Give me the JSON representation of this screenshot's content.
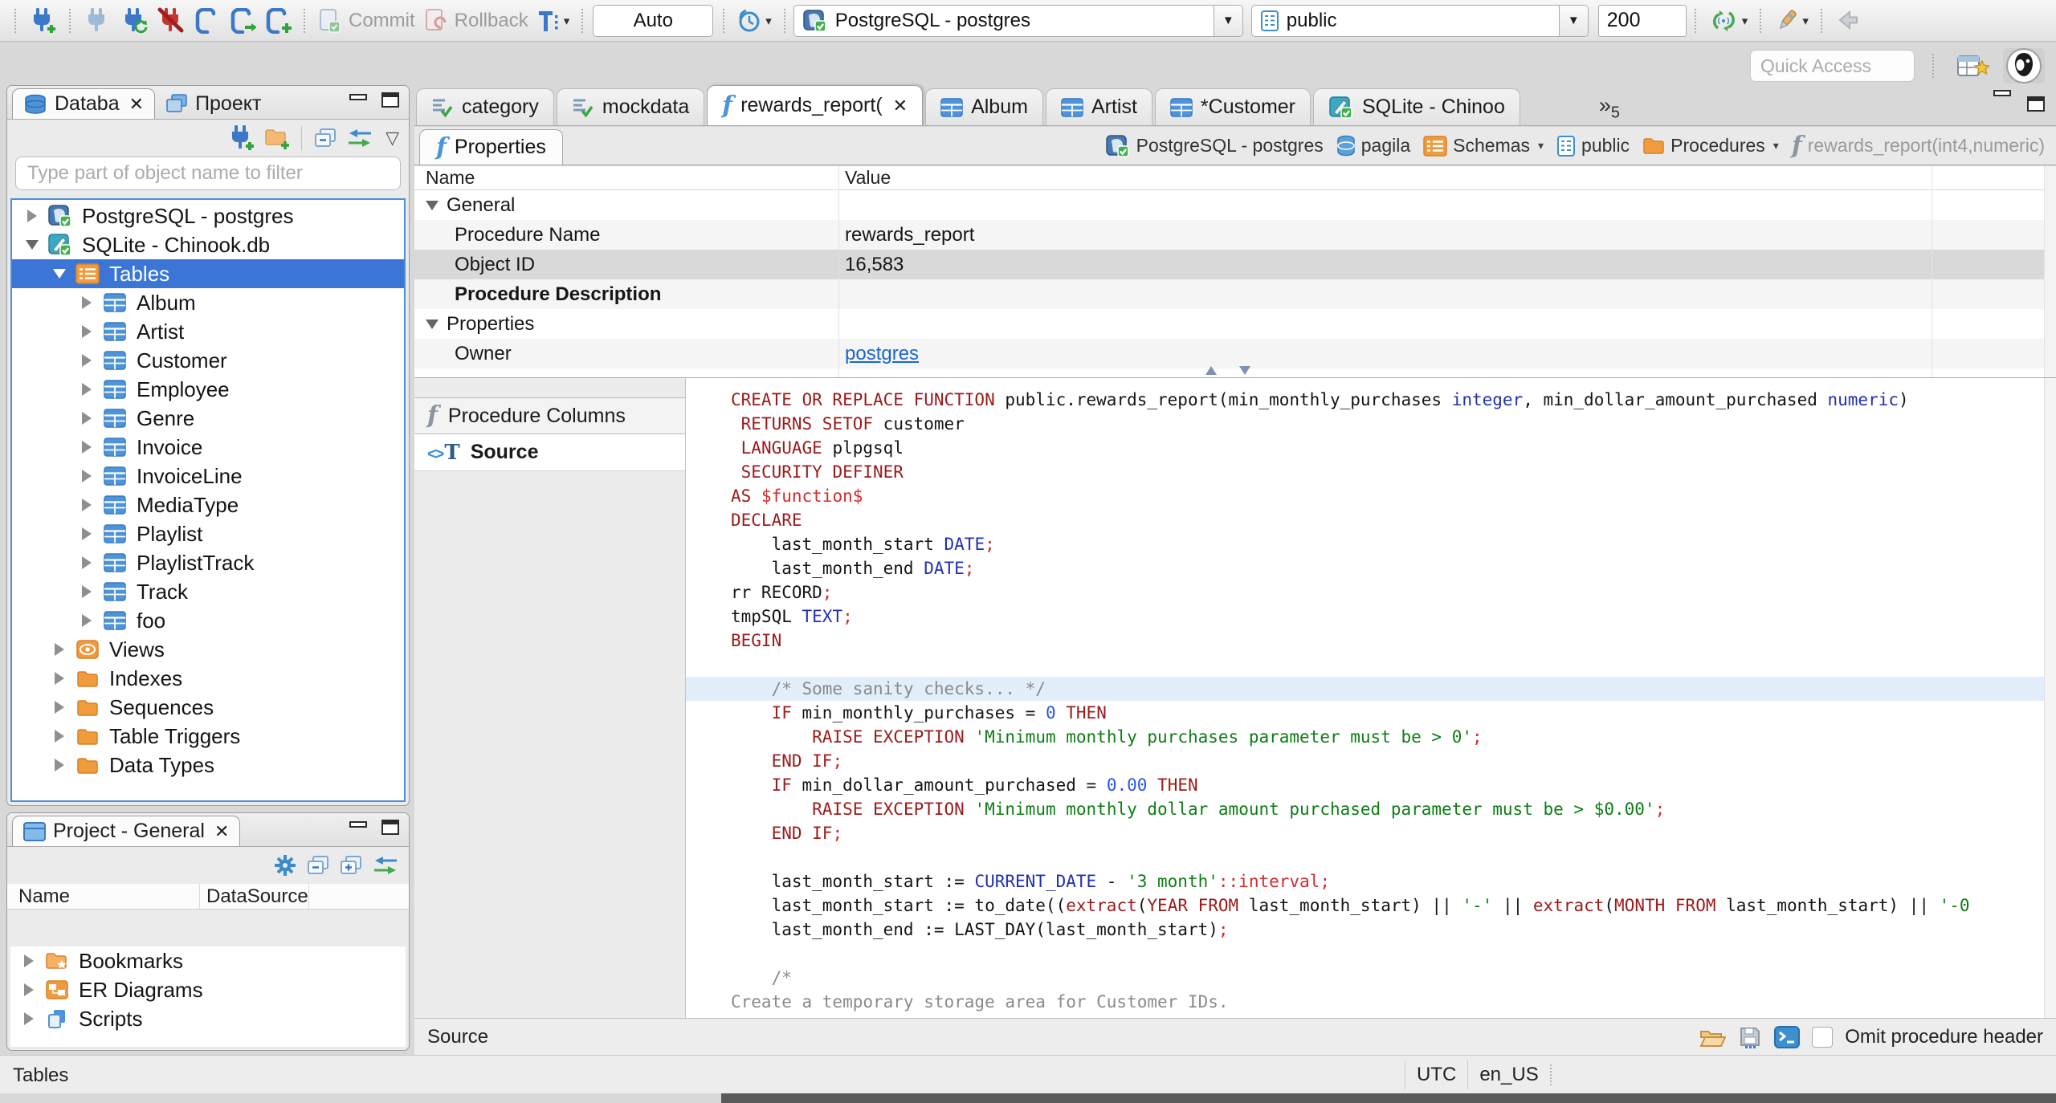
{
  "colors": {
    "selection_blue": "#3B76D6",
    "link_blue": "#1A66CC",
    "keyword": "#9B1A1A",
    "string": "#0E7D14",
    "number": "#2A52F2",
    "type": "#2030B0",
    "comment": "#8A8A8A",
    "punct_red": "#D42A2A",
    "folder_orange": "#F09B3C",
    "icon_blue": "#4D94DB",
    "current_line": "#E2EEFA"
  },
  "toolbar": {
    "commit_label": "Commit",
    "rollback_label": "Rollback",
    "auto_label": "Auto",
    "db_combo": "PostgreSQL - postgres",
    "schema_combo": "public",
    "fetch_size": "200",
    "quick_access_placeholder": "Quick Access"
  },
  "sidebar": {
    "tabs": [
      {
        "label": "Databa",
        "icon": "db-stack",
        "closable": true
      },
      {
        "label": "Проект",
        "icon": "layers"
      }
    ],
    "filter_placeholder": "Type part of object name to filter",
    "tree": [
      {
        "label": "PostgreSQL - postgres",
        "icon": "postgres-db",
        "level": 0,
        "arrow": "right"
      },
      {
        "label": "SQLite - Chinook.db",
        "icon": "sqlite-db",
        "level": 0,
        "arrow": "down"
      },
      {
        "label": "Tables",
        "icon": "tables-folder",
        "level": 1,
        "arrow": "down",
        "selected": true
      },
      {
        "label": "Album",
        "icon": "table",
        "level": 2,
        "arrow": "right"
      },
      {
        "label": "Artist",
        "icon": "table",
        "level": 2,
        "arrow": "right"
      },
      {
        "label": "Customer",
        "icon": "table",
        "level": 2,
        "arrow": "right"
      },
      {
        "label": "Employee",
        "icon": "table",
        "level": 2,
        "arrow": "right"
      },
      {
        "label": "Genre",
        "icon": "table",
        "level": 2,
        "arrow": "right"
      },
      {
        "label": "Invoice",
        "icon": "table",
        "level": 2,
        "arrow": "right"
      },
      {
        "label": "InvoiceLine",
        "icon": "table",
        "level": 2,
        "arrow": "right"
      },
      {
        "label": "MediaType",
        "icon": "table",
        "level": 2,
        "arrow": "right"
      },
      {
        "label": "Playlist",
        "icon": "table",
        "level": 2,
        "arrow": "right"
      },
      {
        "label": "PlaylistTrack",
        "icon": "table",
        "level": 2,
        "arrow": "right"
      },
      {
        "label": "Track",
        "icon": "table",
        "level": 2,
        "arrow": "right"
      },
      {
        "label": "foo",
        "icon": "table",
        "level": 2,
        "arrow": "right"
      },
      {
        "label": "Views",
        "icon": "views",
        "level": 1,
        "arrow": "right"
      },
      {
        "label": "Indexes",
        "icon": "folder",
        "level": 1,
        "arrow": "right"
      },
      {
        "label": "Sequences",
        "icon": "folder",
        "level": 1,
        "arrow": "right"
      },
      {
        "label": "Table Triggers",
        "icon": "folder",
        "level": 1,
        "arrow": "right"
      },
      {
        "label": "Data Types",
        "icon": "folder",
        "level": 1,
        "arrow": "right"
      }
    ]
  },
  "project_panel": {
    "tab_label": "Project - General",
    "columns": [
      "Name",
      "DataSource"
    ],
    "tree": [
      {
        "label": "Bookmarks",
        "icon": "bookmarks-folder"
      },
      {
        "label": "ER Diagrams",
        "icon": "er-diagrams"
      },
      {
        "label": "Scripts",
        "icon": "scripts"
      }
    ]
  },
  "editor_tabs": [
    {
      "label": "category",
      "icon": "script-check"
    },
    {
      "label": "mockdata",
      "icon": "script-check"
    },
    {
      "label": "rewards_report(",
      "icon": "function-blue",
      "active": true,
      "closable": true
    },
    {
      "label": "Album",
      "icon": "table"
    },
    {
      "label": "Artist",
      "icon": "table"
    },
    {
      "label": "*Customer",
      "icon": "table"
    },
    {
      "label": "SQLite - Chinoo",
      "icon": "sqlite-db"
    }
  ],
  "editor_tabs_overflow": "5",
  "properties": {
    "tab_label": "Properties",
    "breadcrumb": [
      {
        "label": "PostgreSQL - postgres",
        "icon": "postgres-db"
      },
      {
        "label": "pagila",
        "icon": "database"
      },
      {
        "label": "Schemas",
        "icon": "tables-folder",
        "dropdown": true
      },
      {
        "label": "public",
        "icon": "page"
      },
      {
        "label": "Procedures",
        "icon": "folder",
        "dropdown": true
      },
      {
        "label": "rewards_report(int4,numeric)",
        "icon": "function-gray",
        "muted": true
      }
    ],
    "columns": [
      "Name",
      "Value"
    ],
    "rows": [
      {
        "name": "General",
        "group": true
      },
      {
        "name": "Procedure Name",
        "value": "rewards_report",
        "alt": true
      },
      {
        "name": "Object ID",
        "value": "16,583",
        "selected": true
      },
      {
        "name": "Procedure Description",
        "bold": true,
        "alt": true
      },
      {
        "name": "Properties",
        "group": true
      },
      {
        "name": "Owner",
        "value": "postgres",
        "link": true,
        "alt": true
      }
    ]
  },
  "subtabs": [
    {
      "label": "Procedure Columns",
      "icon": "function-gray"
    },
    {
      "label": "Source",
      "icon": "source",
      "active": true
    }
  ],
  "code": {
    "lines": [
      {
        "t": [
          [
            "k",
            "CREATE OR REPLACE FUNCTION"
          ],
          [
            "d",
            " public.rewards_report(min_monthly_purchases "
          ],
          [
            "t",
            "integer"
          ],
          [
            "d",
            ", min_dollar_amount_purchased "
          ],
          [
            "t",
            "numeric"
          ],
          [
            "d",
            ")"
          ]
        ]
      },
      {
        "t": [
          [
            "d",
            " "
          ],
          [
            "k",
            "RETURNS SETOF"
          ],
          [
            "d",
            " customer"
          ]
        ]
      },
      {
        "t": [
          [
            "d",
            " "
          ],
          [
            "k",
            "LANGUAGE"
          ],
          [
            "d",
            " plpgsql"
          ]
        ]
      },
      {
        "t": [
          [
            "d",
            " "
          ],
          [
            "k",
            "SECURITY DEFINER"
          ]
        ]
      },
      {
        "t": [
          [
            "k",
            "AS"
          ],
          [
            "d",
            " "
          ],
          [
            "r",
            "$function$"
          ]
        ]
      },
      {
        "t": [
          [
            "k",
            "DECLARE"
          ]
        ]
      },
      {
        "t": [
          [
            "d",
            "    last_month_start "
          ],
          [
            "t",
            "DATE"
          ],
          [
            "r",
            ";"
          ]
        ]
      },
      {
        "t": [
          [
            "d",
            "    last_month_end "
          ],
          [
            "t",
            "DATE"
          ],
          [
            "r",
            ";"
          ]
        ]
      },
      {
        "t": [
          [
            "d",
            "rr RECORD"
          ],
          [
            "r",
            ";"
          ]
        ]
      },
      {
        "t": [
          [
            "d",
            "tmpSQL "
          ],
          [
            "t",
            "TEXT"
          ],
          [
            "r",
            ";"
          ]
        ]
      },
      {
        "t": [
          [
            "k",
            "BEGIN"
          ]
        ]
      },
      {
        "t": []
      },
      {
        "hl": true,
        "t": [
          [
            "c",
            "    /* Some sanity checks... */"
          ]
        ]
      },
      {
        "t": [
          [
            "d",
            "    "
          ],
          [
            "k",
            "IF"
          ],
          [
            "d",
            " min_monthly_purchases = "
          ],
          [
            "n",
            "0"
          ],
          [
            "d",
            " "
          ],
          [
            "k",
            "THEN"
          ]
        ]
      },
      {
        "t": [
          [
            "d",
            "        "
          ],
          [
            "k",
            "RAISE EXCEPTION"
          ],
          [
            "d",
            " "
          ],
          [
            "s",
            "'Minimum monthly purchases parameter must be > 0'"
          ],
          [
            "r",
            ";"
          ]
        ]
      },
      {
        "t": [
          [
            "d",
            "    "
          ],
          [
            "k",
            "END IF"
          ],
          [
            "r",
            ";"
          ]
        ]
      },
      {
        "t": [
          [
            "d",
            "    "
          ],
          [
            "k",
            "IF"
          ],
          [
            "d",
            " min_dollar_amount_purchased = "
          ],
          [
            "n",
            "0.00"
          ],
          [
            "d",
            " "
          ],
          [
            "k",
            "THEN"
          ]
        ]
      },
      {
        "t": [
          [
            "d",
            "        "
          ],
          [
            "k",
            "RAISE EXCEPTION"
          ],
          [
            "d",
            " "
          ],
          [
            "s",
            "'Minimum monthly dollar amount purchased parameter must be > $0.00'"
          ],
          [
            "r",
            ";"
          ]
        ]
      },
      {
        "t": [
          [
            "d",
            "    "
          ],
          [
            "k",
            "END IF"
          ],
          [
            "r",
            ";"
          ]
        ]
      },
      {
        "t": []
      },
      {
        "t": [
          [
            "d",
            "    last_month_start := "
          ],
          [
            "t",
            "CURRENT_DATE"
          ],
          [
            "d",
            " - "
          ],
          [
            "s",
            "'3 month'"
          ],
          [
            "r",
            "::interval;"
          ]
        ]
      },
      {
        "t": [
          [
            "d",
            "    last_month_start := to_date(("
          ],
          [
            "k",
            "extract"
          ],
          [
            "d",
            "("
          ],
          [
            "k",
            "YEAR FROM"
          ],
          [
            "d",
            " last_month_start) || "
          ],
          [
            "s",
            "'-'"
          ],
          [
            "d",
            " || "
          ],
          [
            "k",
            "extract"
          ],
          [
            "d",
            "("
          ],
          [
            "k",
            "MONTH FROM"
          ],
          [
            "d",
            " last_month_start) || "
          ],
          [
            "s",
            "'-0"
          ]
        ]
      },
      {
        "t": [
          [
            "d",
            "    last_month_end := LAST_DAY(last_month_start)"
          ],
          [
            "r",
            ";"
          ]
        ]
      },
      {
        "t": []
      },
      {
        "t": [
          [
            "c",
            "    /*"
          ]
        ]
      },
      {
        "t": [
          [
            "c",
            "Create a temporary storage area for Customer IDs."
          ]
        ]
      },
      {
        "t": [
          [
            "c",
            "*/"
          ]
        ]
      }
    ]
  },
  "editor_footer": {
    "label": "Source",
    "omit_checkbox_label": "Omit procedure header"
  },
  "statusbar": {
    "left": "Tables",
    "timezone": "UTC",
    "locale": "en_US"
  }
}
